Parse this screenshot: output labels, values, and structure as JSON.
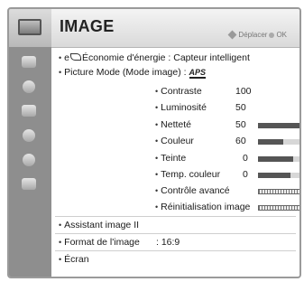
{
  "menu": {
    "title": "IMAGE",
    "nav_hint": "Déplacer",
    "ok_label": "OK"
  },
  "sidebar": {
    "items": [
      {
        "icon": "tv-screen-icon"
      },
      {
        "icon": "audio-icon"
      },
      {
        "icon": "clock-icon"
      },
      {
        "icon": "lock-icon"
      },
      {
        "icon": "options-icon"
      },
      {
        "icon": "usb-icon"
      },
      {
        "icon": "input-icon"
      }
    ]
  },
  "items": {
    "energy_prefix": "e",
    "energy_saving": "Économie d'énergie : Capteur intelligent",
    "picture_mode": "Picture Mode (Mode image)  :",
    "aps_logo": "APS",
    "contrast_label": "Contraste",
    "contrast_value": "100",
    "brightness_label": "Luminosité",
    "brightness_value": "50",
    "sharpness_label": "Netteté",
    "sharpness_value": "50",
    "sharpness_level": 1.0,
    "color_label": "Couleur",
    "color_value": "60",
    "color_level": 0.5,
    "tint_label": "Teinte",
    "tint_value": "0",
    "tint_level": 0.7,
    "color_temp_label": "Temp. couleur",
    "color_temp_value": "0",
    "color_temp_level": 0.65,
    "advanced_control": "Contrôle avancé",
    "picture_reset": "Réinitialisation image",
    "picture_wizard": "Assistant image II",
    "aspect_ratio_label": "Format de l'image",
    "aspect_ratio_value": ": 16:9",
    "screen": "Écran"
  }
}
